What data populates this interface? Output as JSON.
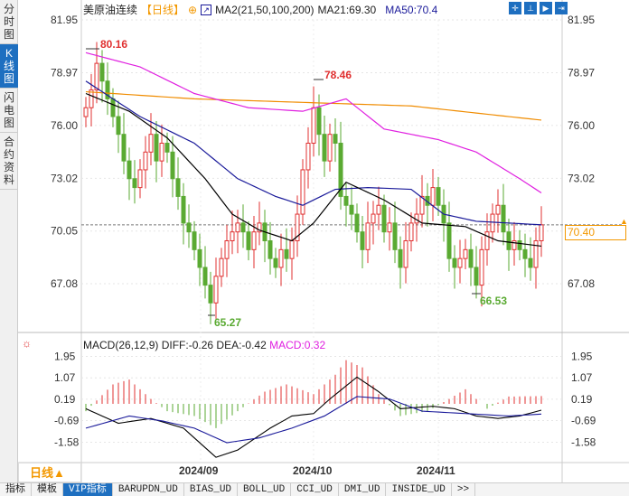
{
  "sidebar": {
    "tabs": [
      {
        "label": "分时图"
      },
      {
        "label": "K线图"
      },
      {
        "label": "闪电图"
      },
      {
        "label": "合约资料"
      }
    ]
  },
  "header": {
    "symbol": "美原油连续",
    "period": "【日线】",
    "indicator": "MA2(21,50,100,200)",
    "ma21": "MA21:69.30",
    "ma50": "MA50:70.4"
  },
  "price_axis": [
    "81.95",
    "78.97",
    "76.00",
    "73.02",
    "70.05",
    "67.08"
  ],
  "last_price": "70.40",
  "annotations": {
    "high1": "80.16",
    "high2": "78.46",
    "low1": "65.27",
    "low2": "66.53"
  },
  "macd": {
    "title": "MACD(26,12,9)",
    "diff": "DIFF:-0.26",
    "dea": "DEA:-0.42",
    "macd": "MACD:0.32",
    "axis": [
      "1.95",
      "1.07",
      "0.19",
      "-0.69",
      "-1.58"
    ]
  },
  "dates": [
    "2024/09",
    "2024/10",
    "2024/11"
  ],
  "period_label": "日线▲",
  "bottom_tabs": [
    "指标",
    "模板",
    "VIP指标",
    "BARUPDN_UD",
    "BIAS_UD",
    "BOLL_UD",
    "CCI_UD",
    "DMI_UD",
    "INSIDE_UD",
    ">>"
  ],
  "colors": {
    "up": "#e03030",
    "down": "#5aaa32",
    "ma50": "#e020e0",
    "ma200": "#f08c00",
    "ma21": "#1a1a9a",
    "ma_black": "#000000",
    "accent": "#1e6fc0"
  },
  "chart_data": {
    "type": "candlestick",
    "ylim": [
      64.5,
      82.5
    ],
    "closes": [
      77.0,
      78.0,
      79.5,
      78.5,
      77.5,
      76.5,
      75.5,
      74.0,
      73.0,
      72.5,
      73.5,
      74.5,
      75.5,
      74.0,
      75.0,
      74.5,
      73.0,
      72.0,
      70.5,
      70.0,
      69.0,
      68.0,
      67.0,
      66.0,
      67.5,
      68.5,
      69.5,
      70.0,
      70.5,
      70.0,
      69.0,
      70.0,
      70.5,
      69.5,
      68.5,
      68.0,
      69.0,
      68.5,
      69.5,
      71.0,
      73.5,
      75.0,
      77.0,
      75.5,
      74.0,
      75.5,
      75.0,
      72.0,
      71.5,
      71.0,
      70.0,
      69.0,
      70.5,
      71.0,
      71.5,
      70.0,
      70.5,
      69.0,
      68.0,
      69.5,
      70.5,
      71.0,
      72.0,
      71.5,
      72.5,
      71.5,
      70.5,
      68.5,
      68.0,
      68.5,
      69.0,
      68.0,
      67.0,
      69.0,
      70.0,
      71.0,
      71.5,
      70.0,
      69.0,
      69.5,
      69.0,
      68.5,
      68.0,
      69.5,
      70.4
    ],
    "ma_lines": [
      {
        "name": "MA200",
        "color": "#f08c00",
        "points": [
          [
            0,
            77.9
          ],
          [
            20,
            77.5
          ],
          [
            40,
            77.3
          ],
          [
            60,
            77.1
          ],
          [
            84,
            76.3
          ]
        ]
      },
      {
        "name": "MA50",
        "color": "#e020e0",
        "points": [
          [
            0,
            80.1
          ],
          [
            10,
            79.3
          ],
          [
            20,
            77.8
          ],
          [
            30,
            77.0
          ],
          [
            40,
            76.8
          ],
          [
            48,
            77.5
          ],
          [
            55,
            75.8
          ],
          [
            65,
            75.2
          ],
          [
            72,
            74.5
          ],
          [
            80,
            73.0
          ],
          [
            84,
            72.2
          ]
        ]
      },
      {
        "name": "MA21",
        "color": "#1a1a9a",
        "points": [
          [
            0,
            78.5
          ],
          [
            10,
            76.5
          ],
          [
            20,
            75.0
          ],
          [
            28,
            73.0
          ],
          [
            35,
            72.0
          ],
          [
            40,
            71.5
          ],
          [
            46,
            72.4
          ],
          [
            52,
            72.5
          ],
          [
            60,
            72.4
          ],
          [
            66,
            71.0
          ],
          [
            72,
            70.6
          ],
          [
            84,
            70.4
          ]
        ]
      },
      {
        "name": "MA",
        "color": "#000000",
        "points": [
          [
            0,
            77.8
          ],
          [
            8,
            76.8
          ],
          [
            15,
            75.3
          ],
          [
            22,
            73.0
          ],
          [
            27,
            71.0
          ],
          [
            32,
            70.1
          ],
          [
            38,
            69.5
          ],
          [
            42,
            70.5
          ],
          [
            48,
            72.8
          ],
          [
            55,
            71.8
          ],
          [
            62,
            70.5
          ],
          [
            70,
            70.3
          ],
          [
            76,
            69.5
          ],
          [
            84,
            69.2
          ]
        ]
      }
    ],
    "macd_hist": [
      [
        0,
        -0.3
      ],
      [
        5,
        0.8
      ],
      [
        8,
        1.0
      ],
      [
        12,
        0.2
      ],
      [
        15,
        -0.3
      ],
      [
        20,
        -0.5
      ],
      [
        24,
        -1.0
      ],
      [
        28,
        -0.3
      ],
      [
        33,
        0.5
      ],
      [
        37,
        0.8
      ],
      [
        42,
        0.4
      ],
      [
        46,
        1.2
      ],
      [
        48,
        1.8
      ],
      [
        51,
        1.5
      ],
      [
        54,
        0.4
      ],
      [
        58,
        -0.5
      ],
      [
        63,
        -0.3
      ],
      [
        67,
        0.2
      ],
      [
        70,
        0.6
      ],
      [
        74,
        -0.2
      ],
      [
        78,
        0.3
      ],
      [
        84,
        0.32
      ]
    ],
    "diff": [
      [
        0,
        -0.2
      ],
      [
        6,
        -0.8
      ],
      [
        12,
        -0.6
      ],
      [
        18,
        -1.0
      ],
      [
        24,
        -2.2
      ],
      [
        28,
        -1.9
      ],
      [
        34,
        -1.0
      ],
      [
        38,
        -0.5
      ],
      [
        42,
        -0.4
      ],
      [
        45,
        0.2
      ],
      [
        50,
        1.1
      ],
      [
        54,
        0.5
      ],
      [
        58,
        -0.2
      ],
      [
        64,
        -0.1
      ],
      [
        68,
        -0.2
      ],
      [
        72,
        -0.5
      ],
      [
        76,
        -0.6
      ],
      [
        80,
        -0.5
      ],
      [
        84,
        -0.26
      ]
    ],
    "dea": [
      [
        0,
        -1.0
      ],
      [
        8,
        -0.5
      ],
      [
        14,
        -0.7
      ],
      [
        20,
        -1.0
      ],
      [
        26,
        -1.6
      ],
      [
        32,
        -1.4
      ],
      [
        38,
        -1.0
      ],
      [
        44,
        -0.5
      ],
      [
        50,
        0.3
      ],
      [
        56,
        0.2
      ],
      [
        62,
        -0.3
      ],
      [
        70,
        -0.4
      ],
      [
        78,
        -0.5
      ],
      [
        84,
        -0.42
      ]
    ]
  }
}
